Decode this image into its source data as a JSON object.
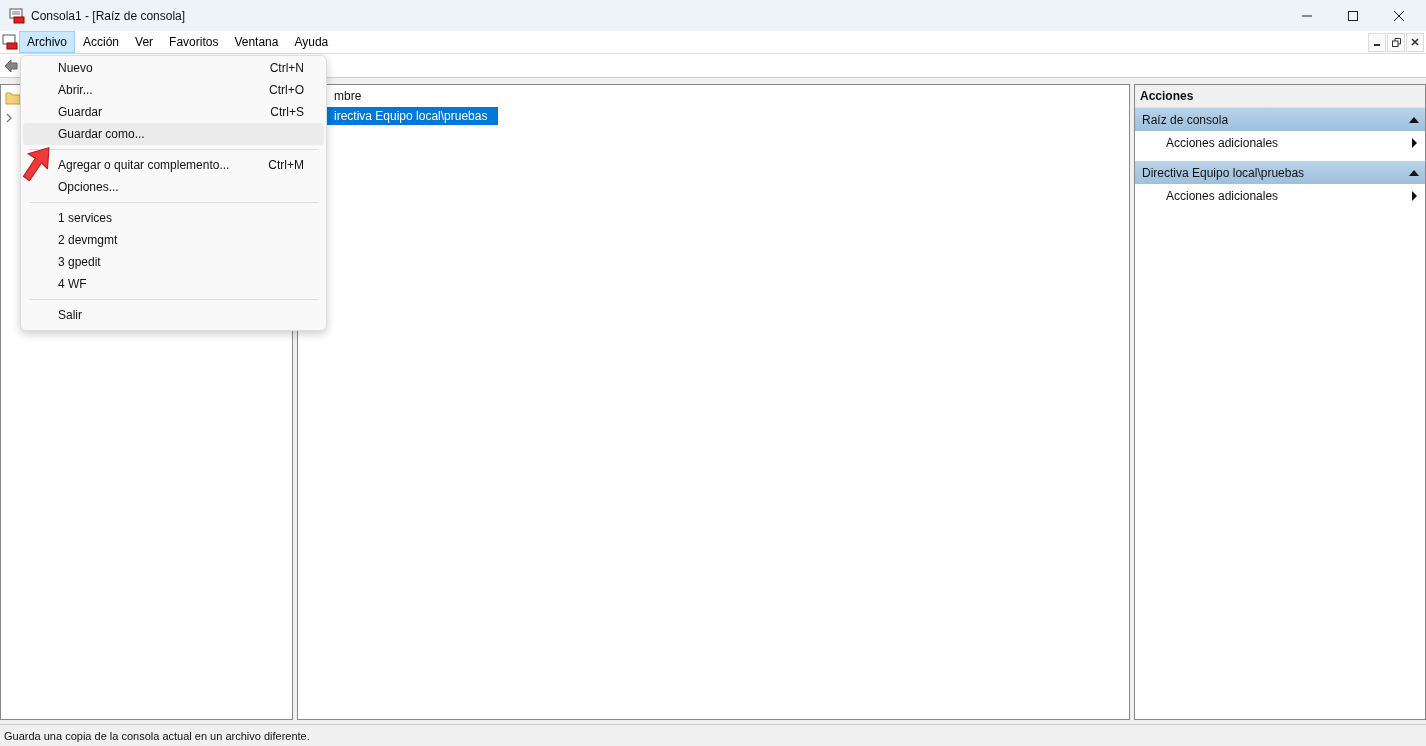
{
  "window": {
    "title": "Consola1 - [Raíz de consola]"
  },
  "menubar": [
    {
      "label": "Archivo",
      "selected": true
    },
    {
      "label": "Acción",
      "selected": false
    },
    {
      "label": "Ver",
      "selected": false
    },
    {
      "label": "Favoritos",
      "selected": false
    },
    {
      "label": "Ventana",
      "selected": false
    },
    {
      "label": "Ayuda",
      "selected": false
    }
  ],
  "file_menu": [
    {
      "kind": "item",
      "label": "Nuevo",
      "shortcut": "Ctrl+N",
      "selected": false
    },
    {
      "kind": "item",
      "label": "Abrir...",
      "shortcut": "Ctrl+O",
      "selected": false
    },
    {
      "kind": "item",
      "label": "Guardar",
      "shortcut": "Ctrl+S",
      "selected": false
    },
    {
      "kind": "item",
      "label": "Guardar como...",
      "selected": true
    },
    {
      "kind": "separator"
    },
    {
      "kind": "item",
      "label": "Agregar o quitar complemento...",
      "shortcut": "Ctrl+M",
      "selected": false
    },
    {
      "kind": "item",
      "label": "Opciones...",
      "selected": false
    },
    {
      "kind": "separator"
    },
    {
      "kind": "item",
      "label": "1 services",
      "selected": false
    },
    {
      "kind": "item",
      "label": "2 devmgmt",
      "selected": false
    },
    {
      "kind": "item",
      "label": "3 gpedit",
      "selected": false
    },
    {
      "kind": "item",
      "label": "4 WF",
      "selected": false
    },
    {
      "kind": "separator"
    },
    {
      "kind": "item",
      "label": "Salir",
      "selected": false
    }
  ],
  "list": {
    "column_1": "mbre",
    "rows": [
      {
        "name": "irectiva Equipo local\\pruebas",
        "selected": true
      }
    ]
  },
  "actions": {
    "title": "Acciones",
    "sections": [
      {
        "title": "Raíz de consola",
        "expanded": true,
        "items": [
          "Acciones adicionales"
        ]
      },
      {
        "title": "Directiva Equipo local\\pruebas",
        "expanded": true,
        "items": [
          "Acciones adicionales"
        ]
      }
    ]
  },
  "status_bar": "Guarda una copia de la consola actual en un archivo diferente."
}
